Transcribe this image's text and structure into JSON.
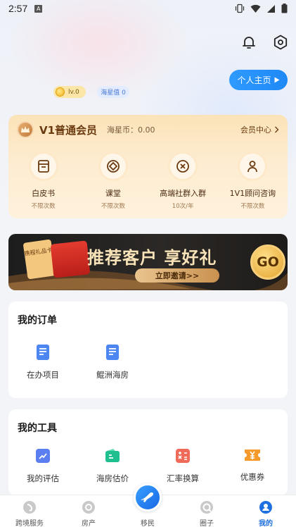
{
  "status_bar": {
    "time": "2:57",
    "notification_badge": "A"
  },
  "header": {
    "homepage_button": "个人主页",
    "level_badge": "lv.0",
    "star_badge": "海星值 0"
  },
  "member_card": {
    "title": "V1普通会员",
    "coins": "海星币：0.00",
    "center_link": "会员中心",
    "items": [
      {
        "label": "白皮书",
        "sub": "不限次数",
        "icon": "book-icon"
      },
      {
        "label": "课堂",
        "sub": "不限次数",
        "icon": "classroom-icon"
      },
      {
        "label": "高端社群入群",
        "sub": "10次/年",
        "icon": "community-icon"
      },
      {
        "label": "1V1顾问咨询",
        "sub": "不限次数",
        "icon": "consultant-icon"
      }
    ]
  },
  "banner": {
    "title": "推荐客户 享好礼",
    "subtitle": "立即邀请>>",
    "go": "GO",
    "gift_card": "携程礼品卡"
  },
  "orders": {
    "title": "我的订单",
    "items": [
      {
        "label": "在办项目",
        "icon": "document-icon"
      },
      {
        "label": "鲲洲海房",
        "icon": "document-icon"
      }
    ]
  },
  "tools": {
    "title": "我的工具",
    "items": [
      {
        "label": "我的评估",
        "icon": "assessment-icon"
      },
      {
        "label": "海房估价",
        "icon": "wallet-icon"
      },
      {
        "label": "汇率换算",
        "icon": "calculator-icon"
      },
      {
        "label": "优惠券",
        "icon": "coupon-icon"
      }
    ]
  },
  "tabbar": {
    "items": [
      {
        "label": "跨境服务"
      },
      {
        "label": "房产"
      },
      {
        "label": "移民"
      },
      {
        "label": "圈子"
      },
      {
        "label": "我的"
      }
    ],
    "active_index": 4
  },
  "colors": {
    "accent": "#1e88f5",
    "gold": "#6b3a10",
    "member_bg": "#fbe3b8"
  }
}
